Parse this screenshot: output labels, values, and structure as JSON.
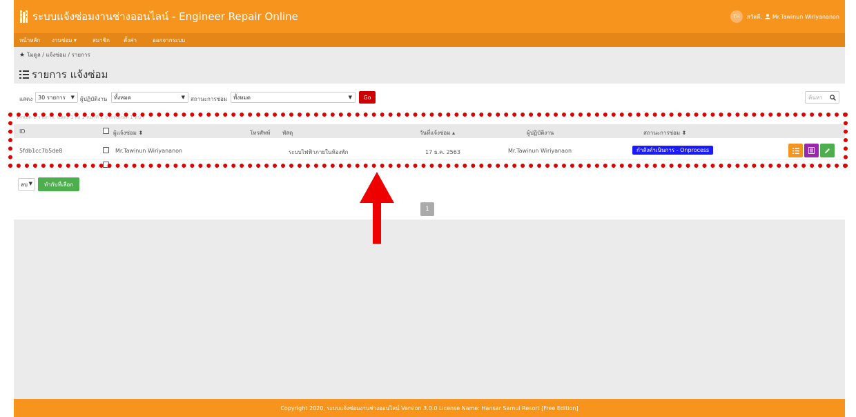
{
  "app": {
    "title": "ระบบแจ้งซ่อมงานช่างออนไลน์ - Engineer Repair Online",
    "avatar_initials": "TH",
    "greeting": "สวัสดี,",
    "user_name": "Mr.Tawinun Wiriyananon"
  },
  "nav": {
    "items": [
      "หน้าหลัก",
      "งานซ่อม ▾",
      "สมาชิก",
      "ตั้งค่า",
      "ออกจากระบบ"
    ]
  },
  "breadcrumb": {
    "text": "โมดูล / แจ้งซ่อม / รายการ"
  },
  "page": {
    "title": "รายการ แจ้งซ่อม"
  },
  "filters": {
    "show_label": "แสดง",
    "show_value": "30 รายการ",
    "worker_label": "ผู้ปฏิบัติงาน",
    "worker_value": "ทั้งหมด",
    "status_label": "สถานะการซ่อม",
    "status_value": "ทั้งหมด",
    "go_label": "Go",
    "search_placeholder": "ค้นหา"
  },
  "summary": {
    "text": "ทั้งหมด 1 รายการ, แสดง 1 ถึง 1 หน้าที่ 1 จากทั้งหมด 1 หน้า"
  },
  "table": {
    "headers": {
      "id": "ID",
      "reporter": "ผู้แจ้งซ่อม ⬍",
      "phone": "โทรศัพท์",
      "item": "พัสดุ",
      "date": "วันที่แจ้งซ่อม ▴",
      "worker": "ผู้ปฏิบัติงาน",
      "status": "สถานะการซ่อม ⬍"
    },
    "rows": [
      {
        "id": "5fdb1cc7b5de8",
        "reporter": "Mr.Tawinun Wiriyananon",
        "phone": "",
        "item": "ระบบไฟฟ้าภายในห้องพัก",
        "date": "17 ธ.ค. 2563",
        "worker": "Mr.Tawinun Wiriyanaon",
        "status": "กำลังดำเนินการ - Onprocess"
      }
    ]
  },
  "bulk": {
    "action_value": "ลบ",
    "apply_label": "ทำกับที่เลือก"
  },
  "pagination": {
    "current": "1"
  },
  "footer": {
    "text": "Copyright 2020, ระบบแจ้งซ่อมงานช่างออนไลน์ Version 3.0.0 License Name: Hansar Samui Resort [Free Edition]"
  },
  "colors": {
    "brand": "#f7941d",
    "nav": "#e58718",
    "go": "#cc0000",
    "status_badge": "#1a1aff",
    "action_orange": "#f7941d",
    "action_purple": "#9b27af",
    "action_green": "#4cae4c",
    "annotation_red": "#dd0000"
  },
  "icons": {
    "logo": "building-icon",
    "user": "user-icon",
    "breadcrumb": "star-icon",
    "title": "list-icon",
    "search": "search-icon",
    "action_detail": "list-icon",
    "action_print": "document-icon",
    "action_edit": "pencil-icon"
  }
}
